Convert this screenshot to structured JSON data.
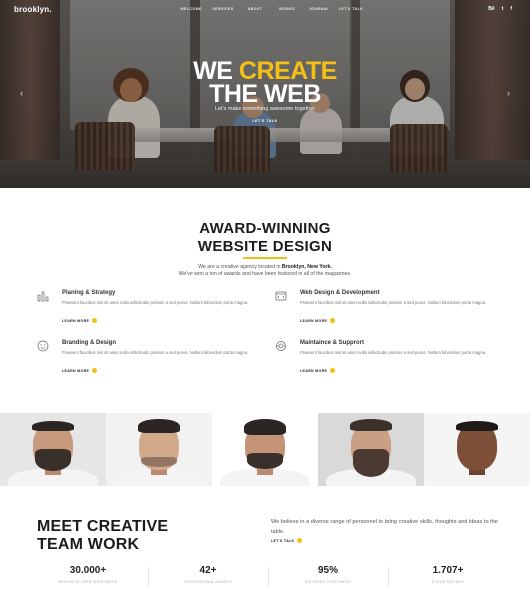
{
  "header": {
    "logo": "brooklyn.",
    "menu": [
      "WELCOME",
      "SERVICES",
      "ABOUT",
      "WORKS",
      "JOURNAL",
      "LET'S TALK"
    ],
    "social": [
      "Bē",
      "t",
      "f"
    ]
  },
  "hero": {
    "title_line1_prefix": "WE ",
    "title_line1_highlight": "CREATE",
    "title_line2": "THE WEB",
    "subtitle": "Let's make something awesome together",
    "cta": "LET'S TALK",
    "prev_arrow": "‹",
    "next_arrow": "›"
  },
  "about": {
    "title_line1": "AWARD-WINNING",
    "title_line2": "WEBSITE DESIGN",
    "intro_prefix": "We are a creative agency located in ",
    "intro_location": "Brooklyn, New York.",
    "intro_line2": "We've won a ton of awards and have been featured in all of the magazines.",
    "services": [
      {
        "icon": "bar-chart-icon",
        "name": "Planing & Strategy",
        "desc": "Praesent faucibus nisl sit amet nulla sollicitudin pretium a sed purus. Nullam bibendum porta magna.",
        "more": "LEARN MORE"
      },
      {
        "icon": "browser-code-icon",
        "name": "Web Design & Development",
        "desc": "Praesent faucibus nisl sit amet nulla sollicitudin pretium a sed purus. Nullam bibendum porta magna.",
        "more": "LEARN MORE"
      },
      {
        "icon": "smiley-icon",
        "name": "Branding & Design",
        "desc": "Praesent faucibus nisl sit amet nulla sollicitudin pretium a sed purus. Nullam bibendum porta magna.",
        "more": "LEARN MORE"
      },
      {
        "icon": "support-lifebuoy-icon",
        "name": "Maintaince & Supprort",
        "desc": "Praesent faucibus nisl sit amet nulla sollicitudin pretium a sed purus. Nullam bibendum porta magna.",
        "more": "LEARN MORE"
      }
    ]
  },
  "team": {
    "title_line1": "MEET CREATIVE",
    "title_line2": "TEAM WORK",
    "text": "We believe in a diverse range of personnel to bring creative skills, thoughts and ideas to the table.",
    "cta": "LET'S TALK",
    "stats": [
      {
        "num": "30.000+",
        "label": "BROOKLYN USER WORLDWIDE"
      },
      {
        "num": "42+",
        "label": "PROFESSIONAL AWARDS"
      },
      {
        "num": "95%",
        "label": "SATISFIED CUSTOMERS"
      },
      {
        "num": "1.707+",
        "label": "5 STAR RATINGS"
      }
    ]
  },
  "colors": {
    "accent": "#f5c016",
    "dark_text": "#1c1c1c"
  }
}
